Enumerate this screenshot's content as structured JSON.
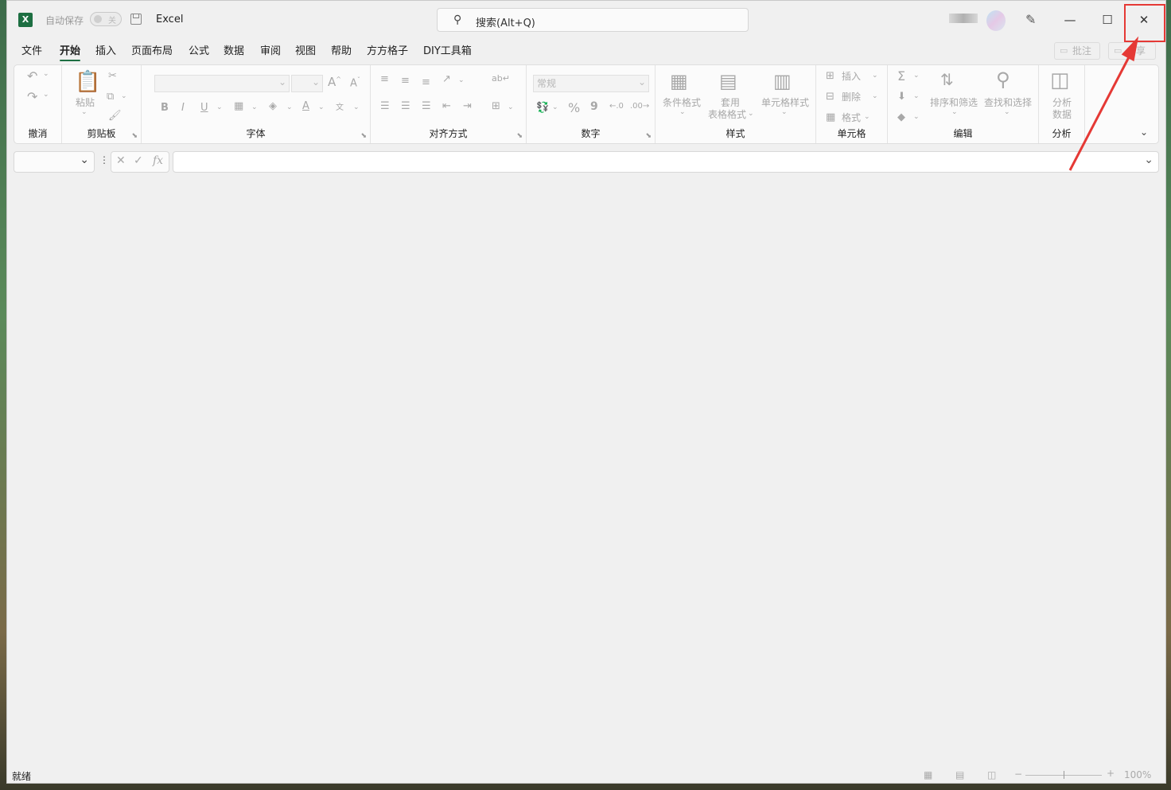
{
  "title_bar": {
    "logo": "X",
    "autosave_label": "自动保存",
    "autosave_state": "关",
    "app_name": "Excel",
    "search_placeholder": "搜索(Alt+Q)",
    "search_icon": "search-icon",
    "minimize": "—",
    "maximize": "☐",
    "close": "✕"
  },
  "tabs": [
    "文件",
    "开始",
    "插入",
    "页面布局",
    "公式",
    "数据",
    "审阅",
    "视图",
    "帮助",
    "方方格子",
    "DIY工具箱"
  ],
  "active_tab": "开始",
  "right_buttons": {
    "comments": "批注",
    "share": "共享"
  },
  "ribbon": {
    "groups": {
      "undo": "撤消",
      "clipboard": "剪贴板",
      "font": "字体",
      "alignment": "对齐方式",
      "number": "数字",
      "styles": "样式",
      "cells": "单元格",
      "editing": "编辑",
      "analysis": "分析"
    },
    "paste": "粘贴",
    "bold": "B",
    "italic": "I",
    "underline": "U",
    "number_format": "常规",
    "percent": "%",
    "comma": "9",
    "conditional_format": "条件格式",
    "table_format_1": "套用",
    "table_format_2": "表格格式",
    "cell_styles": "单元格样式",
    "insert": "插入",
    "delete": "删除",
    "format": "格式",
    "sort_filter": "排序和筛选",
    "find_select": "查找和选择",
    "analyze_1": "分析",
    "analyze_2": "数据"
  },
  "formula_bar": {
    "fx": "fx",
    "cancel": "✕",
    "confirm": "✓"
  },
  "status_bar": {
    "status": "就绪",
    "zoom": "100%"
  },
  "colors": {
    "accent": "#1d6f42",
    "highlight": "#e53935"
  }
}
